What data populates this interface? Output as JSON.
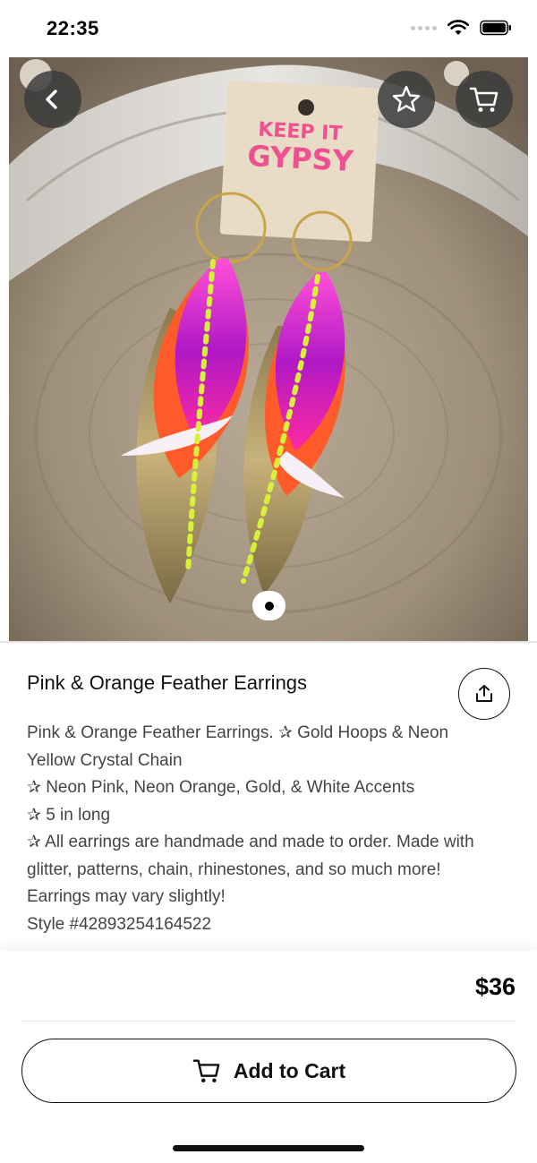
{
  "status_bar": {
    "time": "22:35"
  },
  "product_image": {
    "card_text_line1": "KEEP IT",
    "card_text_line2": "GYPSY",
    "alt": "photo-of-earrings"
  },
  "header_actions": {
    "back_icon": "chevron-left-icon",
    "favorite_icon": "star-icon",
    "cart_icon": "cart-icon"
  },
  "product": {
    "title": "Pink & Orange Feather Earrings",
    "description_lines": [
      "Pink & Orange Feather Earrings. ✰ Gold Hoops & Neon Yellow Crystal Chain",
      "✰ Neon Pink, Neon Orange, Gold, & White Accents",
      "✰ 5 in long",
      "✰ All earrings are handmade and made to order. Made with glitter, patterns, chain, rhinestones, and so much more! Earrings may vary slightly!",
      "Style #42893254164522"
    ],
    "price": "$36"
  },
  "actions": {
    "share_icon": "share-icon",
    "add_to_cart_label": "Add to Cart"
  },
  "colors": {
    "pink": "#e01fa0",
    "orange": "#ff5a2a",
    "neon_yellow": "#d7f03a",
    "gold": "#b49a5e"
  }
}
